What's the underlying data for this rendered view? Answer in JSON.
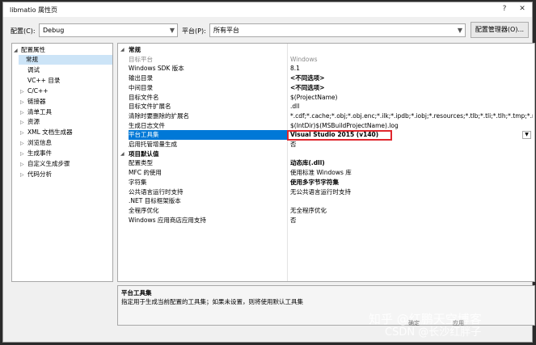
{
  "window": {
    "title": "libmatio 属性页",
    "help": "?",
    "close": "✕"
  },
  "config": {
    "config_label": "配置(C):",
    "config_value": "Debug",
    "platform_label": "平台(P):",
    "platform_value": "所有平台",
    "manager_button": "配置管理器(O)..."
  },
  "tree": {
    "root": "配置属性",
    "items": [
      {
        "label": "常规",
        "selected": true,
        "expandable": false
      },
      {
        "label": "调试",
        "expandable": false
      },
      {
        "label": "VC++ 目录",
        "expandable": false
      },
      {
        "label": "C/C++",
        "expandable": true
      },
      {
        "label": "链接器",
        "expandable": true
      },
      {
        "label": "清单工具",
        "expandable": true
      },
      {
        "label": "资源",
        "expandable": true
      },
      {
        "label": "XML 文档生成器",
        "expandable": true
      },
      {
        "label": "浏览信息",
        "expandable": true
      },
      {
        "label": "生成事件",
        "expandable": true
      },
      {
        "label": "自定义生成步骤",
        "expandable": true
      },
      {
        "label": "代码分析",
        "expandable": true
      }
    ]
  },
  "grid": {
    "sections": [
      {
        "title": "常规",
        "rows": [
          {
            "name": "目标平台",
            "value": "Windows",
            "dim": true
          },
          {
            "name": "Windows SDK 版本",
            "value": "8.1"
          },
          {
            "name": "输出目录",
            "value": "<不同选项>",
            "bold": true
          },
          {
            "name": "中间目录",
            "value": "<不同选项>",
            "bold": true
          },
          {
            "name": "目标文件名",
            "value": "$(ProjectName)"
          },
          {
            "name": "目标文件扩展名",
            "value": ".dll"
          },
          {
            "name": "清除时要删除的扩展名",
            "value": "*.cdf;*.cache;*.obj;*.obj.enc;*.ilk;*.ipdb;*.iobj;*.resources;*.tlb;*.tli;*.tlh;*.tmp;*.rsp;*.pgc;*.pgd"
          },
          {
            "name": "生成日志文件",
            "value": "$(IntDir)$(MSBuildProjectName).log"
          },
          {
            "name": "平台工具集",
            "value": "Visual Studio 2015 (v140)",
            "bold": true,
            "selected": true
          },
          {
            "name": "启用托管增量生成",
            "value": "否"
          }
        ]
      },
      {
        "title": "项目默认值",
        "rows": [
          {
            "name": "配置类型",
            "value": "动态库(.dll)",
            "bold": true
          },
          {
            "name": "MFC 的使用",
            "value": "使用标准 Windows 库"
          },
          {
            "name": "字符集",
            "value": "使用多字节字符集",
            "bold": true
          },
          {
            "name": "公共语言运行时支持",
            "value": "无公共语言运行时支持"
          },
          {
            "name": ".NET 目标框架版本",
            "value": ""
          },
          {
            "name": "全程序优化",
            "value": "无全程序优化"
          },
          {
            "name": "Windows 应用商店应用支持",
            "value": "否"
          }
        ]
      }
    ]
  },
  "description": {
    "title": "平台工具集",
    "text": "指定用于生成当前配置的工具集；如果未设置，则将使用默认工具集"
  },
  "watermark": {
    "line1": "知乎 @红鹏天空博客",
    "line2": "CSDN @长沙红胖子",
    "btn_left": "确定",
    "btn_right": "应用"
  },
  "colors": {
    "selection": "#0078d7",
    "highlight_box": "#e0282e"
  }
}
